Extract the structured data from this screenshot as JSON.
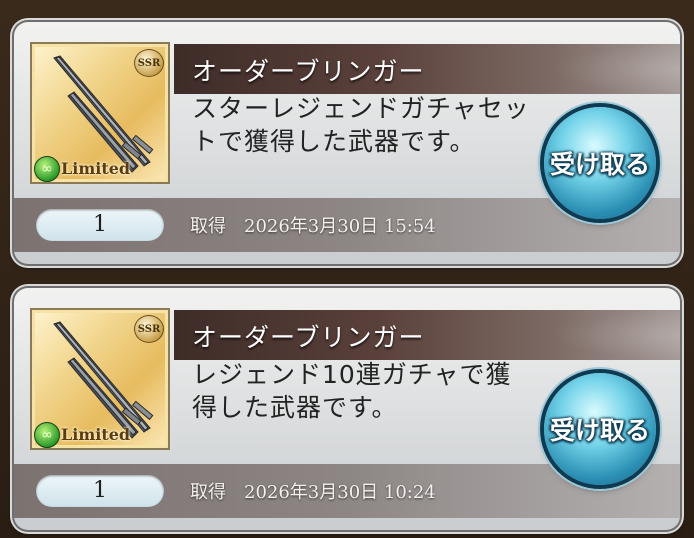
{
  "items": [
    {
      "name": "オーダーブリンガー",
      "description": "スターレジェンドガチャセットで獲得した武器です。",
      "rarity": "SSR",
      "badge": "Limited",
      "quantity": "1",
      "obtained_label": "取得",
      "obtained_time": "2026年3月30日 15:54",
      "action_label": "受け取る"
    },
    {
      "name": "オーダーブリンガー",
      "description": "レジェンド10連ガチャで獲得した武器です。",
      "rarity": "SSR",
      "badge": "Limited",
      "quantity": "1",
      "obtained_label": "取得",
      "obtained_time": "2026年3月30日 10:24",
      "action_label": "受け取る"
    }
  ],
  "colors": {
    "button_blue": "#2a8fb3",
    "title_band": "#3e2c28",
    "badge_green": "#2e9b2a"
  },
  "icons": {
    "weapon": "sword-icon",
    "rarity": "ssr-icon",
    "limited": "limited-icon"
  }
}
